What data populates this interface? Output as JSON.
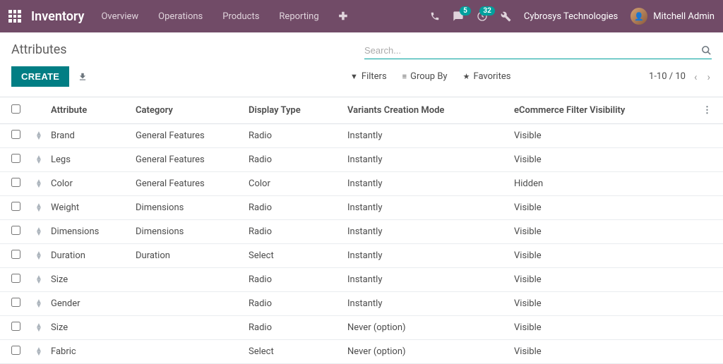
{
  "nav": {
    "app_title": "Inventory",
    "items": [
      "Overview",
      "Operations",
      "Products",
      "Reporting"
    ],
    "chat_badge": "5",
    "activity_badge": "32",
    "company": "Cybrosys Technologies",
    "user_name": "Mitchell Admin"
  },
  "page": {
    "title": "Attributes",
    "create_label": "CREATE",
    "search_placeholder": "Search...",
    "filters_label": "Filters",
    "groupby_label": "Group By",
    "favorites_label": "Favorites",
    "pager": "1-10 / 10"
  },
  "table": {
    "headers": {
      "attribute": "Attribute",
      "category": "Category",
      "display_type": "Display Type",
      "variants_mode": "Variants Creation Mode",
      "ecommerce": "eCommerce Filter Visibility"
    },
    "rows": [
      {
        "attribute": "Brand",
        "category": "General Features",
        "display_type": "Radio",
        "variants_mode": "Instantly",
        "ecommerce": "Visible"
      },
      {
        "attribute": "Legs",
        "category": "General Features",
        "display_type": "Radio",
        "variants_mode": "Instantly",
        "ecommerce": "Visible"
      },
      {
        "attribute": "Color",
        "category": "General Features",
        "display_type": "Color",
        "variants_mode": "Instantly",
        "ecommerce": "Hidden"
      },
      {
        "attribute": "Weight",
        "category": "Dimensions",
        "display_type": "Radio",
        "variants_mode": "Instantly",
        "ecommerce": "Visible"
      },
      {
        "attribute": "Dimensions",
        "category": "Dimensions",
        "display_type": "Radio",
        "variants_mode": "Instantly",
        "ecommerce": "Visible"
      },
      {
        "attribute": "Duration",
        "category": "Duration",
        "display_type": "Select",
        "variants_mode": "Instantly",
        "ecommerce": "Visible"
      },
      {
        "attribute": "Size",
        "category": "",
        "display_type": "Radio",
        "variants_mode": "Instantly",
        "ecommerce": "Visible"
      },
      {
        "attribute": "Gender",
        "category": "",
        "display_type": "Radio",
        "variants_mode": "Instantly",
        "ecommerce": "Visible"
      },
      {
        "attribute": "Size",
        "category": "",
        "display_type": "Radio",
        "variants_mode": "Never (option)",
        "ecommerce": "Visible"
      },
      {
        "attribute": "Fabric",
        "category": "",
        "display_type": "Select",
        "variants_mode": "Never (option)",
        "ecommerce": "Visible"
      }
    ]
  }
}
